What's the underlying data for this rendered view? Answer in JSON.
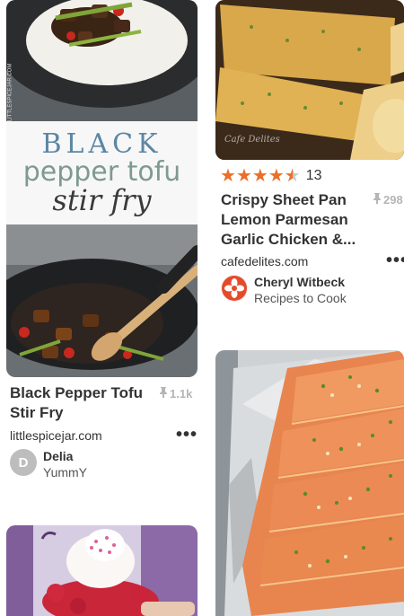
{
  "pins": [
    {
      "title": "Black Pepper Tofu Stir Fry",
      "title_line1": "Black Pepper Tofu",
      "title_line2": "Stir Fry",
      "saves": "1.1k",
      "domain": "littlespicejar.com",
      "user": "Delia",
      "board": "YummY",
      "avatar_letter": "D",
      "image_overlay": {
        "line1": "BLACK",
        "line2": "pepper tofu",
        "line3": "stir fry",
        "watermark": "LITTLESPICEJAR.COM"
      }
    },
    {
      "title_line1": "Crispy Sheet Pan",
      "title_line2": "Lemon Parmesan",
      "title_line3": "Garlic Chicken &...",
      "rating": 4.5,
      "rating_count": "13",
      "saves": "298",
      "domain": "cafedelites.com",
      "user": "Cheryl Witbeck",
      "board": "Recipes to Cook",
      "image_watermark": "Cafe Delites"
    },
    {
      "image": "strawberry-shortcake"
    },
    {
      "image": "foil-baked-salmon"
    }
  ],
  "colors": {
    "text": "#333333",
    "saves_gray": "#b5b5b5",
    "star_orange": "#e8702a",
    "avatar_gray": "#bdbdbd",
    "avatar_red": "#e54b2a"
  }
}
